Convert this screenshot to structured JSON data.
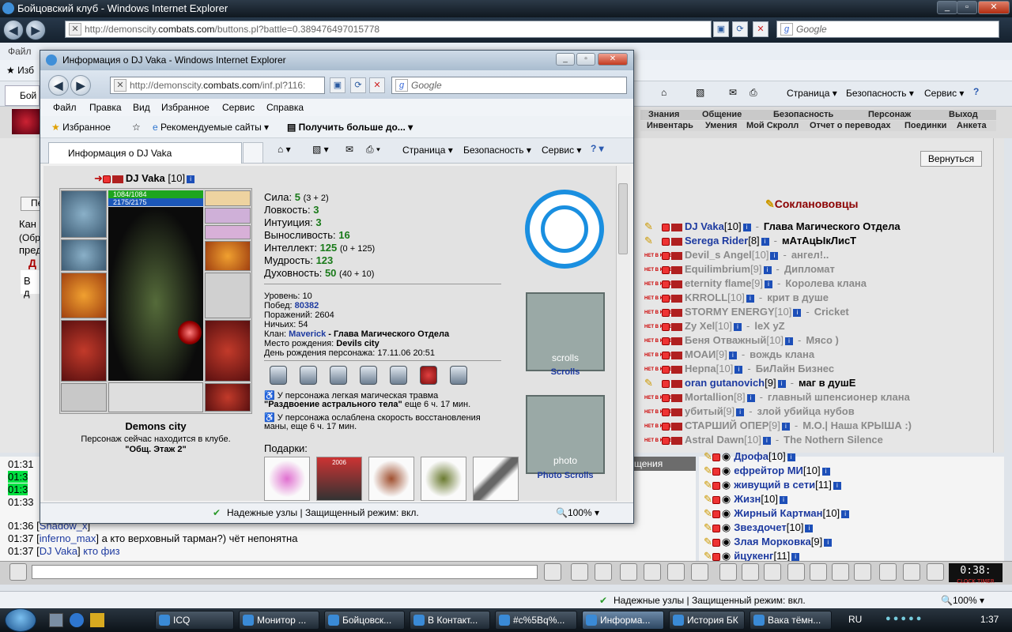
{
  "main_window": {
    "title": "Бойцовский клуб - Windows Internet Explorer",
    "url_prefix": "http://demonscity.",
    "url_domain": "combats.com",
    "url_rest": "/buttons.pl?battle=0.389476497015778",
    "search_placeholder": "Google",
    "menu_items": [
      "Файл"
    ],
    "fav_label": "Изб",
    "tab_label": "Бой",
    "toolbar": {
      "page": "Страница",
      "security": "Безопасность",
      "service": "Сервис"
    },
    "status": "Надежные узлы | Защищенный режим: вкл.",
    "zoom": "100%"
  },
  "game": {
    "menu_top": [
      "Знания",
      "Общение",
      "Безопасность",
      "Персонаж",
      "Выход"
    ],
    "menu_bottom": [
      "Инвентарь",
      "Умения",
      "Мой Скролл",
      "Отчет о переводах",
      "Поединки",
      "Анкета"
    ],
    "back_button": "Вернуться",
    "left_partial": [
      "Пе",
      "Кан",
      "(Обр",
      "пред",
      "Д",
      "В д"
    ],
    "clan_title": "Сокланововцы",
    "not_in_club": "НЕТ В КЛУБЕ",
    "clan_members": [
      {
        "name": "DJ Vaka",
        "level": "[10]",
        "status": "Глава Магического Отдела",
        "online": true
      },
      {
        "name": "Serega Rider",
        "level": "[8]",
        "status": "мАтАцЫкЛисТ",
        "online": true
      },
      {
        "name": "Devil_s Angel",
        "level": "[10]",
        "status": "ангел!..",
        "online": false
      },
      {
        "name": "Equilimbrium",
        "level": "[9]",
        "status": "Дипломат",
        "online": false
      },
      {
        "name": "eternity flame",
        "level": "[9]",
        "status": "Королева клана",
        "online": false
      },
      {
        "name": "KRROLL",
        "level": "[10]",
        "status": "крит в душе",
        "online": false
      },
      {
        "name": "STORMY ENERGY",
        "level": "[10]",
        "status": "Cricket",
        "online": false
      },
      {
        "name": "Zy Xel",
        "level": "[10]",
        "status": "leX yZ",
        "online": false
      },
      {
        "name": "Беня Отважный",
        "level": "[10]",
        "status": "Мясо )",
        "online": false
      },
      {
        "name": "МОАИ",
        "level": "[9]",
        "status": "вождь клана",
        "online": false
      },
      {
        "name": "Нерпа",
        "level": "[10]",
        "status": "БиЛайн Бизнес",
        "online": false
      },
      {
        "name": "oran gutanovich",
        "level": "[9]",
        "status": "маг в душЕ",
        "online": true
      },
      {
        "name": "Mortallion",
        "level": "[8]",
        "status": "главный шпенсионер клана",
        "online": false
      },
      {
        "name": "убитый",
        "level": "[9]",
        "status": "злой убийца нубов",
        "online": false
      },
      {
        "name": "СТАРШИЙ ОПЕР",
        "level": "[9]",
        "status": "М.О.| Наша КРЫША :)",
        "online": false
      },
      {
        "name": "Astral Dawn",
        "level": "[10]",
        "status": "The Nothern Silence",
        "online": false
      }
    ],
    "chat_tab": "щения",
    "chat_lines": [
      {
        "time": "01:31",
        "name": "",
        "text": ""
      },
      {
        "time": "01:3",
        "name": "",
        "text": ""
      },
      {
        "time": "01:3",
        "name": "",
        "text": ""
      },
      {
        "time": "01:33",
        "name": "",
        "text": ""
      },
      {
        "time": "01:36",
        "name": "Shadow_x",
        "text": ""
      },
      {
        "time": "01:37",
        "name": "inferno_max",
        "text": "а кто верховный тарман?) чёт непонятна"
      },
      {
        "time": "01:37",
        "name": "DJ Vaka",
        "text": "кто физ"
      }
    ],
    "online_users": [
      {
        "name": "Дрофа",
        "level": "[10]"
      },
      {
        "name": "ефрейтор МИ",
        "level": "[10]"
      },
      {
        "name": "живущий в сети",
        "level": "[11]"
      },
      {
        "name": "Жизн",
        "level": "[10]"
      },
      {
        "name": "Жирный Картман",
        "level": "[10]"
      },
      {
        "name": "Звездочет",
        "level": "[10]"
      },
      {
        "name": "Злая Морковка",
        "level": "[9]"
      },
      {
        "name": "йцукенг",
        "level": "[11]"
      }
    ],
    "clock": "0:38:",
    "clock_label": "CLOCK TIMER"
  },
  "taskbar": {
    "items": [
      "ICQ",
      "Монитор ...",
      "Бойцовск...",
      "В Контакт...",
      "#c%5Bq%...",
      "Информа...",
      "История БК",
      "Вака тёмн..."
    ],
    "active_index": 5,
    "lang": "RU",
    "time": "1:37"
  },
  "popup": {
    "title": "Информация о DJ Vaka - Windows Internet Explorer",
    "url_prefix": "http://demonscity.",
    "url_domain": "combats.com",
    "url_rest": "/inf.pl?116:",
    "search_placeholder": "Google",
    "menu": [
      "Файл",
      "Правка",
      "Вид",
      "Избранное",
      "Сервис",
      "Справка"
    ],
    "fav": {
      "favorites": "Избранное",
      "recommended": "Рекомендуемые сайты",
      "more": "Получить больше до..."
    },
    "tab_label": "Информация о DJ Vaka",
    "toolbar": {
      "page": "Страница",
      "security": "Безопасность",
      "service": "Сервис"
    },
    "status": "Надежные узлы | Защищенный режим: вкл.",
    "zoom": "100%"
  },
  "character": {
    "name": "DJ Vaka",
    "level": "[10]",
    "hp": "1084/1084",
    "mana": "2175/2175",
    "city": "Demons city",
    "location_note": "Персонаж сейчас находится в клубе.",
    "location": "\"Общ. Этаж 2\"",
    "stats": [
      {
        "label": "Сила:",
        "value": "5",
        "extra": "(3 + 2)"
      },
      {
        "label": "Ловкость:",
        "value": "3",
        "extra": ""
      },
      {
        "label": "Интуиция:",
        "value": "3",
        "extra": ""
      },
      {
        "label": "Выносливость:",
        "value": "16",
        "extra": ""
      },
      {
        "label": "Интеллект:",
        "value": "125",
        "extra": "(0 + 125)"
      },
      {
        "label": "Мудрость:",
        "value": "123",
        "extra": ""
      },
      {
        "label": "Духовность:",
        "value": "50",
        "extra": "(40 + 10)"
      }
    ],
    "level_line": "Уровень: 10",
    "wins_label": "Побед:",
    "wins": "80382",
    "losses": "Поражений: 2604",
    "draws": "Ничьих: 54",
    "clan_label": "Клан:",
    "clan_name": "Maverick",
    "clan_role": "- Глава Магического Отдела",
    "birthplace_label": "Место рождения:",
    "birthplace": "Devils city",
    "birthday": "День рождения персонажа: 17.11.06 20:51",
    "trauma1": "У персонажа легкая магическая травма",
    "trauma1_name": "\"Раздвоение астрального тела\"",
    "trauma1_time": "еще 6 ч. 17 мин.",
    "trauma2": "У персонажа ослаблена скорость восстановления",
    "trauma2_time": "маны, еще 6 ч. 17 мин.",
    "gifts_label": "Подарки:",
    "gift_year": "2006",
    "scrolls_label": "Scrolls",
    "scrolls_banner": "scrolls",
    "photo_label": "Photo Scrolls",
    "photo_banner": "photo"
  }
}
